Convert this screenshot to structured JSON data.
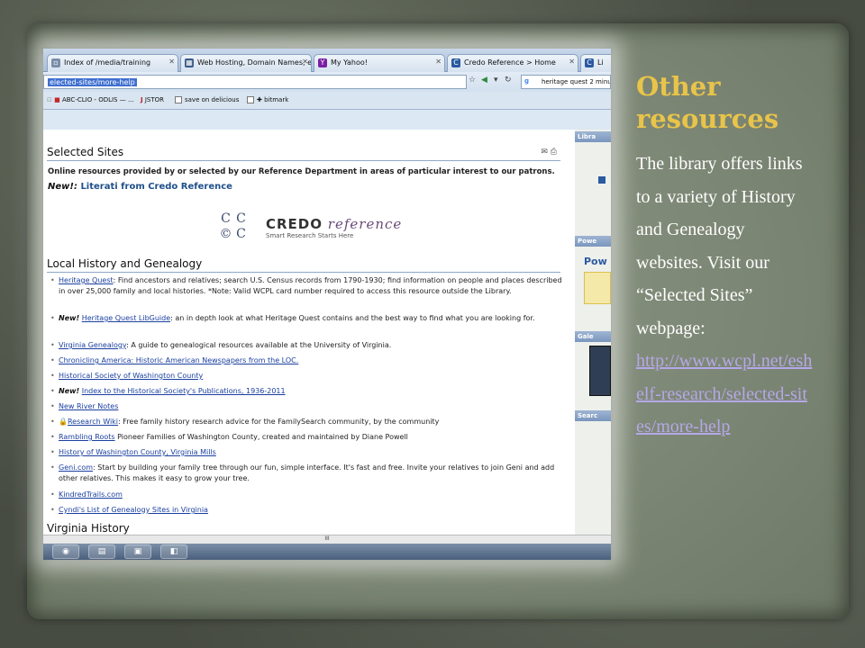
{
  "slide": {
    "title_line1": "Other",
    "title_line2": "resources",
    "body": "The library offers links to a variety of History and Genealogy websites. Visit our “Selected Sites” webpage:",
    "link": "http://www.wcpl.net/eshelf-research/selected-sites/more-help",
    "title_color": "#e8c44a",
    "link_color": "#b4a8e8"
  },
  "browser": {
    "tabs": [
      {
        "label": "Index of /media/training",
        "icon": "page-icon"
      },
      {
        "label": "Web Hosting, Domain Names, eC...",
        "icon": "grid-icon"
      },
      {
        "label": "My Yahoo!",
        "icon": "yahoo-icon"
      },
      {
        "label": "Credo Reference > Home",
        "icon": "credo-icon"
      },
      {
        "label": "Li",
        "icon": "credo-icon"
      }
    ],
    "url": "elected-sites/more-help",
    "search_text": "heritage quest 2 minu",
    "bookmarks": [
      "ABC-CLIO - ODLIS — ...",
      "JSTOR",
      "save on delicious",
      "bitmark"
    ]
  },
  "page": {
    "heading": "Selected Sites",
    "intro": "Online resources provided by or selected by our Reference Department in areas of particular interest to our patrons.",
    "new_prefix": "New!",
    "new_colon": ":",
    "literati": "Literati from Credo Reference",
    "credo": {
      "bold": "CREDO",
      "italic": "reference",
      "tagline": "Smart Research Starts Here"
    },
    "section_local": "Local History and Genealogy",
    "section_virginia": "Virginia History",
    "items": [
      {
        "link": "Heritage Quest",
        "text": ": Find ancestors and relatives; search U.S. Census records from 1790-1930; find information on people and places described in over 25,000 family and local histories. *Note: Valid WCPL card number required to access this resource outside the Library."
      },
      {
        "new": "New!",
        "link": "Heritage Quest LibGuide",
        "text": ": an in depth look at what Heritage Quest contains and the best way to find what you are looking for."
      },
      {
        "link": "Virginia Genealogy",
        "text": ": A guide to genealogical resources available at the University of Virginia."
      },
      {
        "link": "Chronicling America: Historic American Newspapers from the LOC.",
        "text": ""
      },
      {
        "link": "Historical Society of Washington County",
        "text": ""
      },
      {
        "new": "New!",
        "link": "Index to the Historical Society's Publications, 1936-2011",
        "text": ""
      },
      {
        "link": "New River Notes",
        "text": ""
      },
      {
        "link": "Research Wiki",
        "text": ": Free family history research advice for the FamilySearch community, by the community"
      },
      {
        "link": "Rambling Roots",
        "text": " Pioneer Families of Washington County, created and maintained by Diane Powell"
      },
      {
        "link": "History of Washington County, Virginia Mills",
        "text": ""
      },
      {
        "link": "Geni.com",
        "text": ": Start by building your family tree through our fun, simple interface. It's fast and free. Invite your relatives to join Geni and add other relatives. This makes it easy to grow your tree."
      },
      {
        "link": "KindredTrails.com",
        "text": ""
      },
      {
        "link": "Cyndi's List of Genealogy Sites in Virginia",
        "text": ""
      }
    ],
    "sidebar": [
      "Libra",
      "Powe",
      "Gale",
      "Searc"
    ],
    "sidebar_pow": "Pow",
    "scroll_marker": "III"
  }
}
